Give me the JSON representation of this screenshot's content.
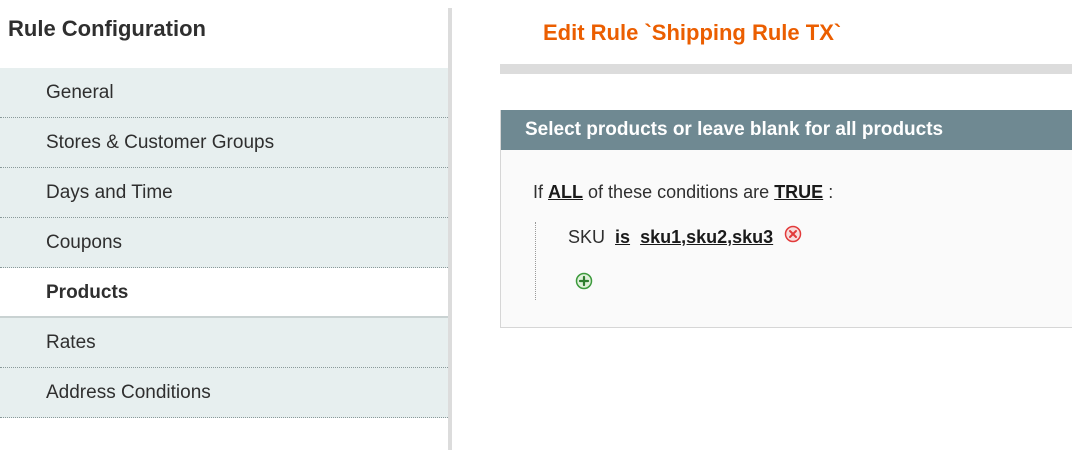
{
  "sidebar": {
    "title": "Rule Configuration",
    "tabs": [
      {
        "label": "General",
        "active": false
      },
      {
        "label": "Stores & Customer Groups",
        "active": false
      },
      {
        "label": "Days and Time",
        "active": false
      },
      {
        "label": "Coupons",
        "active": false
      },
      {
        "label": "Products",
        "active": true
      },
      {
        "label": "Rates",
        "active": false
      },
      {
        "label": "Address Conditions",
        "active": false
      }
    ]
  },
  "main": {
    "title": "Edit Rule `Shipping Rule TX`",
    "panel": {
      "header": "Select products or leave blank for all products",
      "conditions": {
        "if_prefix": "If",
        "aggregator": "ALL",
        "middle": "of these conditions are",
        "value": "TRUE",
        "suffix": ":",
        "rule": {
          "attribute": "SKU",
          "operator": "is",
          "value": "sku1,sku2,sku3"
        }
      }
    }
  },
  "icons": {
    "remove": "remove-circle-icon",
    "add": "add-circle-icon"
  },
  "colors": {
    "title_orange": "#eb5e00",
    "panel_header_bg": "#6f8992",
    "tab_bg": "#e7efef",
    "remove_red": "#e23a3a",
    "add_green": "#3c9a3c"
  }
}
